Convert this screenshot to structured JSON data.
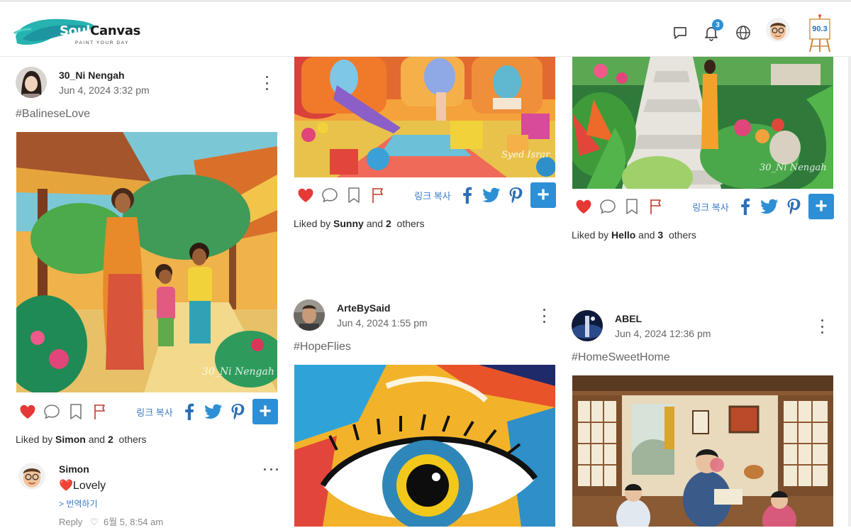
{
  "app": {
    "logo_brand_first": "Soul",
    "logo_brand_second": "Canvas",
    "logo_tagline": "PAINT YOUR DAY",
    "notification_count": "3",
    "points": "90.3",
    "accent_color": "#2d8fd5"
  },
  "posts": [
    {
      "author": "30_Ni Nengah",
      "date": "Jun 4, 2024 3:32 pm",
      "tag": "#BalineseLove",
      "copy_link": "링크 복사",
      "liked_prefix": "Liked by",
      "liked_user": "Simon",
      "liked_and": "and",
      "liked_count": "2",
      "liked_suffix": "others",
      "image_signature": "30_Ni Nengah",
      "comment": {
        "name": "Simon",
        "text": "❤️Lovely",
        "translate": "> 번역하기",
        "reply": "Reply",
        "time": "6월 5, 8:54 am"
      }
    },
    {
      "copy_link": "링크 복사",
      "liked_prefix": "Liked by",
      "liked_user": "Sunny",
      "liked_and": "and",
      "liked_count": "2",
      "liked_suffix": "others",
      "image_signature": "Syed Israr"
    },
    {
      "copy_link": "링크 복사",
      "liked_prefix": "Liked by",
      "liked_user": "Hello",
      "liked_and": "and",
      "liked_count": "3",
      "liked_suffix": "others",
      "image_signature": "30_Ni Nengah"
    },
    {
      "author": "ArteBySaid",
      "date": "Jun 4, 2024 1:55 pm",
      "tag": "#HopeFlies"
    },
    {
      "author": "ABEL",
      "date": "Jun 4, 2024 12:36 pm",
      "tag": "#HomeSweetHome"
    }
  ]
}
